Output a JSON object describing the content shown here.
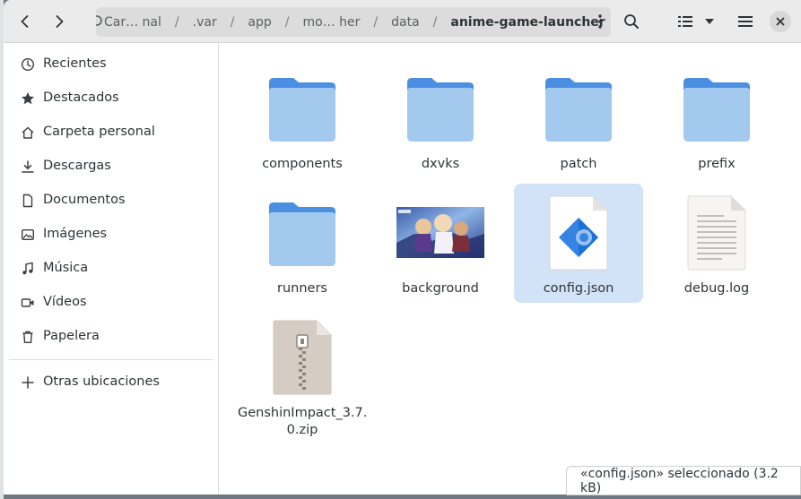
{
  "pathbar": {
    "crumbs": [
      "Car… nal",
      ".var",
      "app",
      "mo… her",
      "data"
    ],
    "separator": "/",
    "current": "anime-game-launcher"
  },
  "sidebar": {
    "items": [
      {
        "label": "Recientes",
        "icon": "clock-icon"
      },
      {
        "label": "Destacados",
        "icon": "star-icon"
      },
      {
        "label": "Carpeta personal",
        "icon": "home-icon"
      },
      {
        "label": "Descargas",
        "icon": "download-icon"
      },
      {
        "label": "Documentos",
        "icon": "document-icon"
      },
      {
        "label": "Imágenes",
        "icon": "image-icon"
      },
      {
        "label": "Música",
        "icon": "music-icon"
      },
      {
        "label": "Vídeos",
        "icon": "video-icon"
      },
      {
        "label": "Papelera",
        "icon": "trash-icon"
      }
    ],
    "other_locations": "Otras ubicaciones"
  },
  "files": [
    {
      "name": "components",
      "type": "folder"
    },
    {
      "name": "dxvks",
      "type": "folder"
    },
    {
      "name": "patch",
      "type": "folder"
    },
    {
      "name": "prefix",
      "type": "folder"
    },
    {
      "name": "runners",
      "type": "folder"
    },
    {
      "name": "background",
      "type": "image"
    },
    {
      "name": "config.json",
      "type": "json",
      "selected": true
    },
    {
      "name": "debug.log",
      "type": "text"
    },
    {
      "name": "GenshinImpact_3.7.0.zip",
      "name_lines": [
        "GenshinImpact_3.7.",
        "0.zip"
      ],
      "type": "archive"
    }
  ],
  "status": {
    "text": "«config.json» seleccionado (3.2 kB)"
  },
  "colors": {
    "folder_body": "#a4c9ef",
    "folder_tab": "#4a8fe2",
    "selection": "#d2e2f7",
    "accent": "#3584e4"
  }
}
